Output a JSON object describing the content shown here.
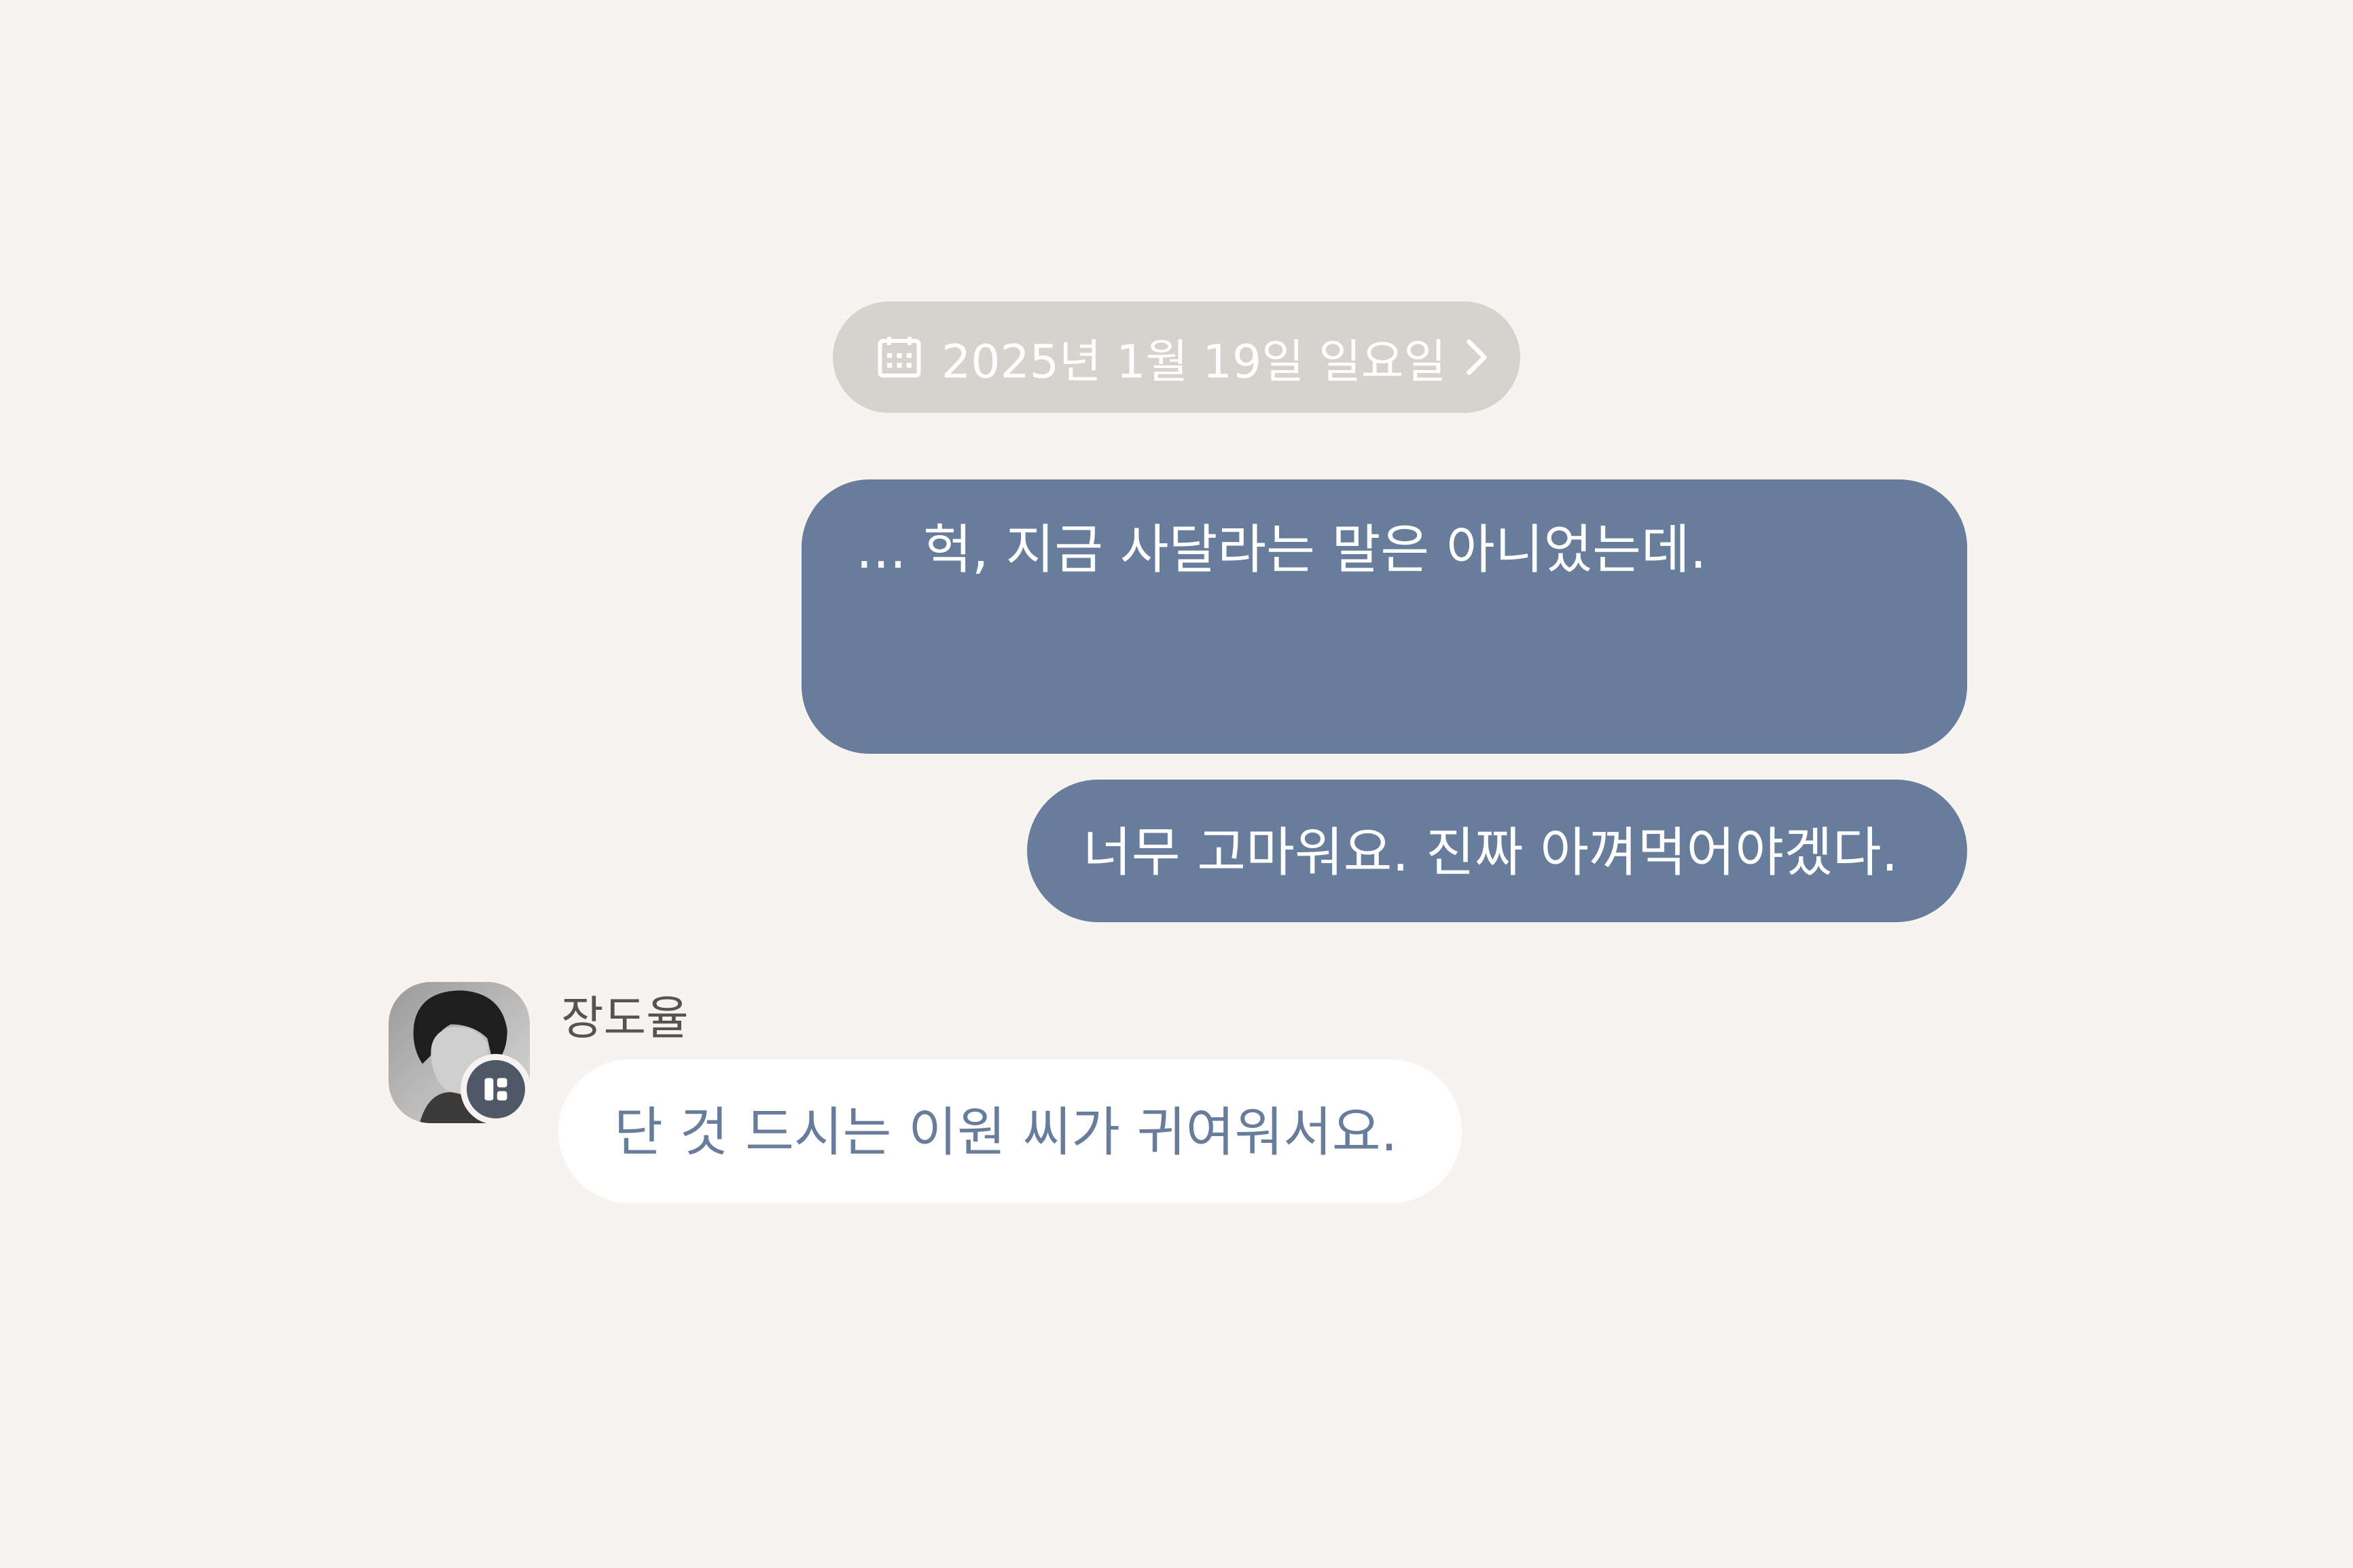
{
  "date_divider": {
    "icon": "calendar-icon",
    "label": "2025년 1월 19일 일요일",
    "chevron": "chevron-right-icon"
  },
  "messages": [
    {
      "sender": "me",
      "text": "... 헉, 지금 사달라는 말은 아니었는데."
    },
    {
      "sender": "me",
      "text": "너무 고마워요. 진짜 아껴먹어야겠다."
    },
    {
      "sender": "other",
      "name": "장도율",
      "text": "단 것 드시는 이원 씨가 귀여워서요."
    }
  ],
  "colors": {
    "background": "#f7f3f0",
    "my_bubble": "#687d9c",
    "their_bubble": "#ffffff",
    "their_text": "#687d9c",
    "date_pill": "#d6d2ce"
  }
}
